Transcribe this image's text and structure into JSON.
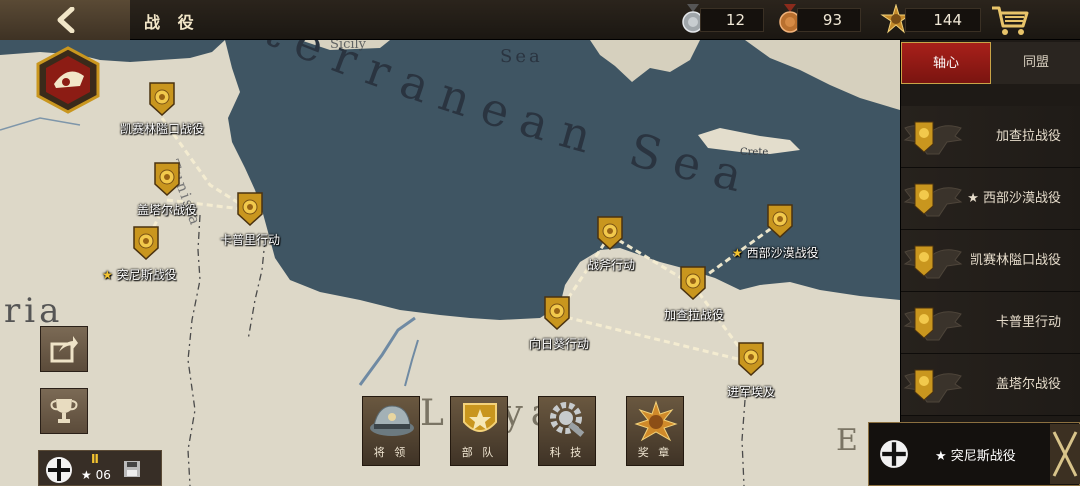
{
  "header": {
    "title": "战 役"
  },
  "resources": [
    {
      "icon": "silver-medal-icon",
      "value": "12"
    },
    {
      "icon": "bronze-medal-icon",
      "value": "93"
    },
    {
      "icon": "gold-star-badge-icon",
      "value": "144"
    }
  ],
  "map_labels": {
    "sicily": "Sicily",
    "sea_top": "Sea",
    "mediterranean": "iterranean Sea",
    "tunisia": "Tunisia",
    "crete": "Crete",
    "algeria": "ria",
    "libya": "Libya",
    "egypt": "E"
  },
  "campaign_nodes": [
    {
      "label": "凯赛林隘口战役",
      "starred": false
    },
    {
      "label": "盖塔尔战役",
      "starred": false
    },
    {
      "label": "卡普里行动",
      "starred": false
    },
    {
      "label": "突尼斯战役",
      "starred": true
    },
    {
      "label": "战斧行动",
      "starred": false
    },
    {
      "label": "西部沙漠战役",
      "starred": true
    },
    {
      "label": "加查拉战役",
      "starred": false
    },
    {
      "label": "向日葵行动",
      "starred": false
    },
    {
      "label": "进军埃及",
      "starred": false
    }
  ],
  "panel": {
    "tabs": [
      {
        "label": "轴心",
        "active": true
      },
      {
        "label": "同盟",
        "active": false
      }
    ],
    "items": [
      {
        "label": "加查拉战役"
      },
      {
        "label": "★ 西部沙漠战役"
      },
      {
        "label": "凯赛林隘口战役"
      },
      {
        "label": "卡普里行动"
      },
      {
        "label": "盖塔尔战役"
      }
    ],
    "selected": "★ 突尼斯战役"
  },
  "player": {
    "rank": "Ⅱ",
    "stars": "★ 06"
  },
  "bottom_buttons": [
    {
      "label": "将 领",
      "icon": "officer-cap-icon"
    },
    {
      "label": "部 队",
      "icon": "unit-badge-icon"
    },
    {
      "label": "科 技",
      "icon": "tech-gear-icon"
    },
    {
      "label": "奖 章",
      "icon": "medal-award-icon"
    }
  ],
  "colors": {
    "sea": "#3f5563",
    "land": "#ddd8c8",
    "gold": "#c9961e",
    "axis_red": "#a8201a"
  }
}
